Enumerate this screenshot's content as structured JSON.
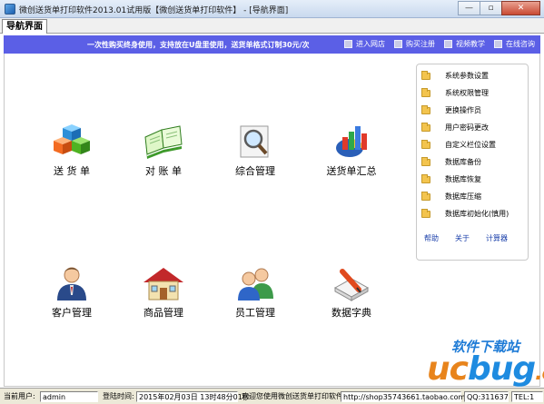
{
  "window": {
    "title": "微创送货单打印软件2013.01试用版【微创送货单打印软件】 - [导航界面]",
    "min_label": "—",
    "restore_label": "▫",
    "close_label": "✕"
  },
  "tab": {
    "label": "导航界面"
  },
  "banner": {
    "promo": "一次性购买终身使用，支持放在U盘里使用，送货单格式订制30元/次",
    "links": [
      "进入网店",
      "购买注册",
      "视频教学",
      "在线咨询"
    ]
  },
  "modules": [
    {
      "label": "送 货 单",
      "icon": "cubes-icon"
    },
    {
      "label": "对 账 单",
      "icon": "open-book-icon"
    },
    {
      "label": "综合管理",
      "icon": "magnifier-icon"
    },
    {
      "label": "送货单汇总",
      "icon": "chart-icon"
    },
    {
      "label": "客户管理",
      "icon": "person-icon"
    },
    {
      "label": "商品管理",
      "icon": "house-icon"
    },
    {
      "label": "员工管理",
      "icon": "people-icon"
    },
    {
      "label": "数据字典",
      "icon": "book-pen-icon"
    }
  ],
  "panel": {
    "items": [
      "系统参数设置",
      "系统权限管理",
      "更换操作员",
      "用户密码更改",
      "自定义栏位设置",
      "数据库备份",
      "数据库恢复",
      "数据库压缩",
      "数据库初始化(慎用)"
    ],
    "links": [
      "帮助",
      "关于",
      "计算器"
    ]
  },
  "watermark": {
    "cn": "软件下载站",
    "uc": "uc",
    "bug": "bug",
    "cc": ".cc"
  },
  "status": {
    "user_label": "当前用户:",
    "user_value": "admin",
    "login_label": "登陆时间:",
    "login_value": "2015年02月03日 13时48分01秒",
    "welcome": "欢迎您使用微创送货单打印软件",
    "shop": "http://shop35743661.taobao.com",
    "qq": "QQ:311637",
    "tel": "TEL:1"
  }
}
